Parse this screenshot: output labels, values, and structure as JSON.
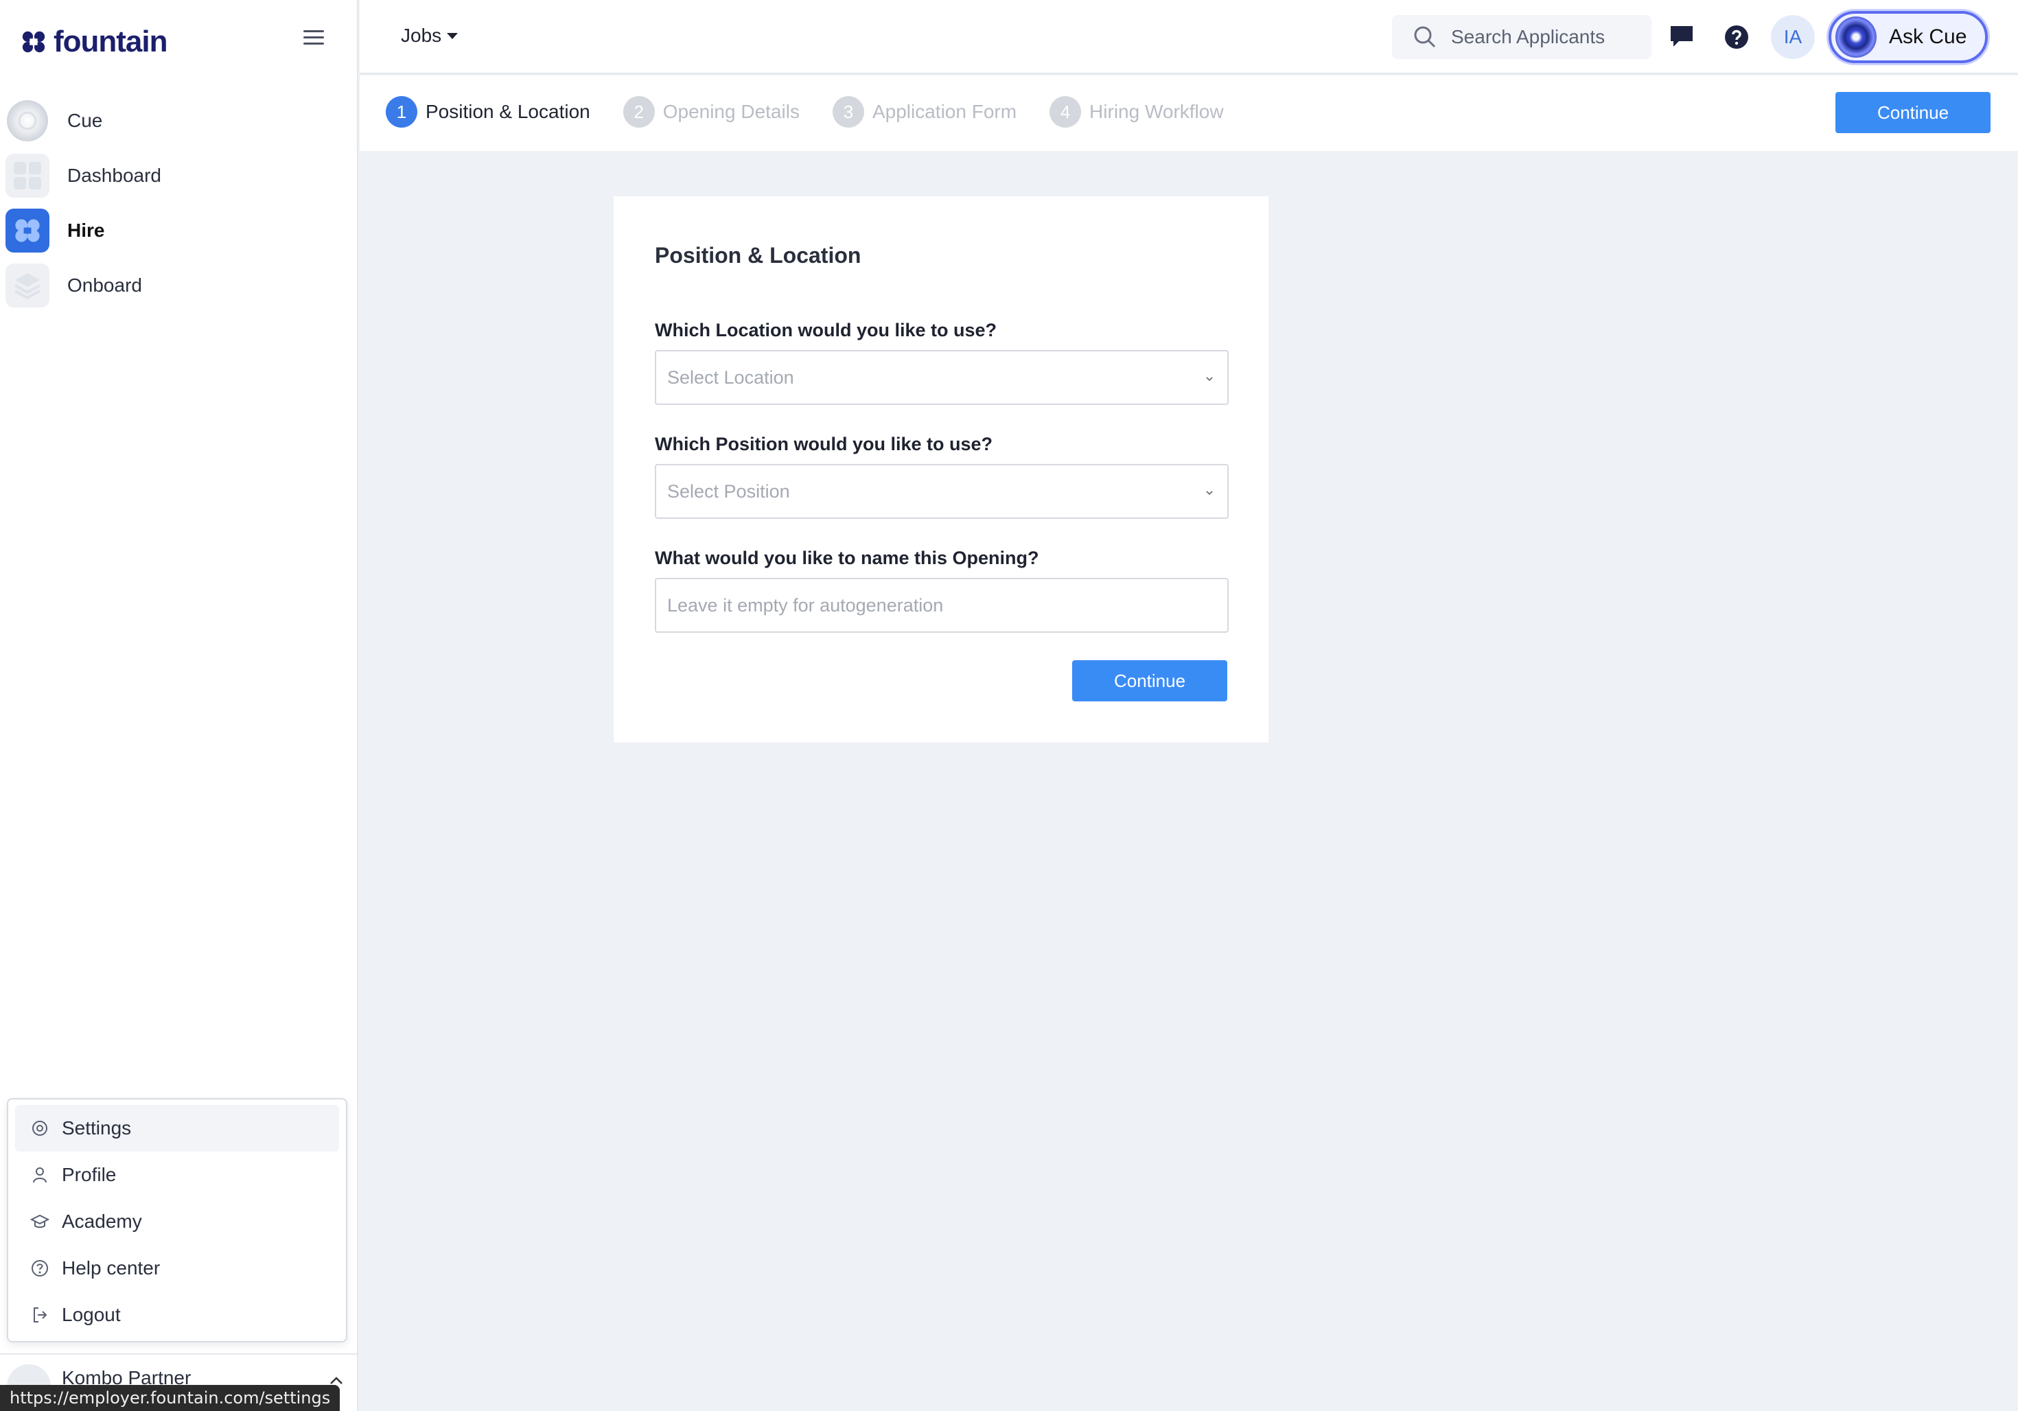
{
  "brand": {
    "name": "fountain",
    "color": "#1b1f6b"
  },
  "sidebar": {
    "items": [
      {
        "label": "Cue",
        "icon": "cue-orb-icon"
      },
      {
        "label": "Dashboard",
        "icon": "dashboard-grid-icon"
      },
      {
        "label": "Hire",
        "icon": "hire-fountain-icon",
        "active": true
      },
      {
        "label": "Onboard",
        "icon": "onboard-layers-icon"
      }
    ],
    "user_menu": [
      {
        "label": "Settings",
        "icon": "gear-icon"
      },
      {
        "label": "Profile",
        "icon": "person-icon"
      },
      {
        "label": "Academy",
        "icon": "graduation-cap-icon"
      },
      {
        "label": "Help center",
        "icon": "question-circle-icon"
      },
      {
        "label": "Logout",
        "icon": "logout-icon"
      }
    ],
    "account_name": "Kombo Partner"
  },
  "status_bar_url": "https://employer.fountain.com/settings",
  "topbar": {
    "jobs_label": "Jobs",
    "search_placeholder": "Search Applicants",
    "avatar_initials": "IA",
    "ask_cue_label": "Ask Cue"
  },
  "steps": [
    {
      "number": "1",
      "label": "Position & Location",
      "active": true
    },
    {
      "number": "2",
      "label": "Opening Details",
      "active": false
    },
    {
      "number": "3",
      "label": "Application Form",
      "active": false
    },
    {
      "number": "4",
      "label": "Hiring Workflow",
      "active": false
    }
  ],
  "continue_label": "Continue",
  "form": {
    "title": "Position & Location",
    "location_label": "Which Location would you like to use?",
    "location_placeholder": "Select Location",
    "position_label": "Which Position would you like to use?",
    "position_placeholder": "Select Position",
    "name_label": "What would you like to name this Opening?",
    "name_placeholder": "Leave it empty for autogeneration",
    "continue_label": "Continue"
  },
  "colors": {
    "primary": "#3a8cf5",
    "step_active": "#3a7bea",
    "background": "#eef2f7"
  }
}
